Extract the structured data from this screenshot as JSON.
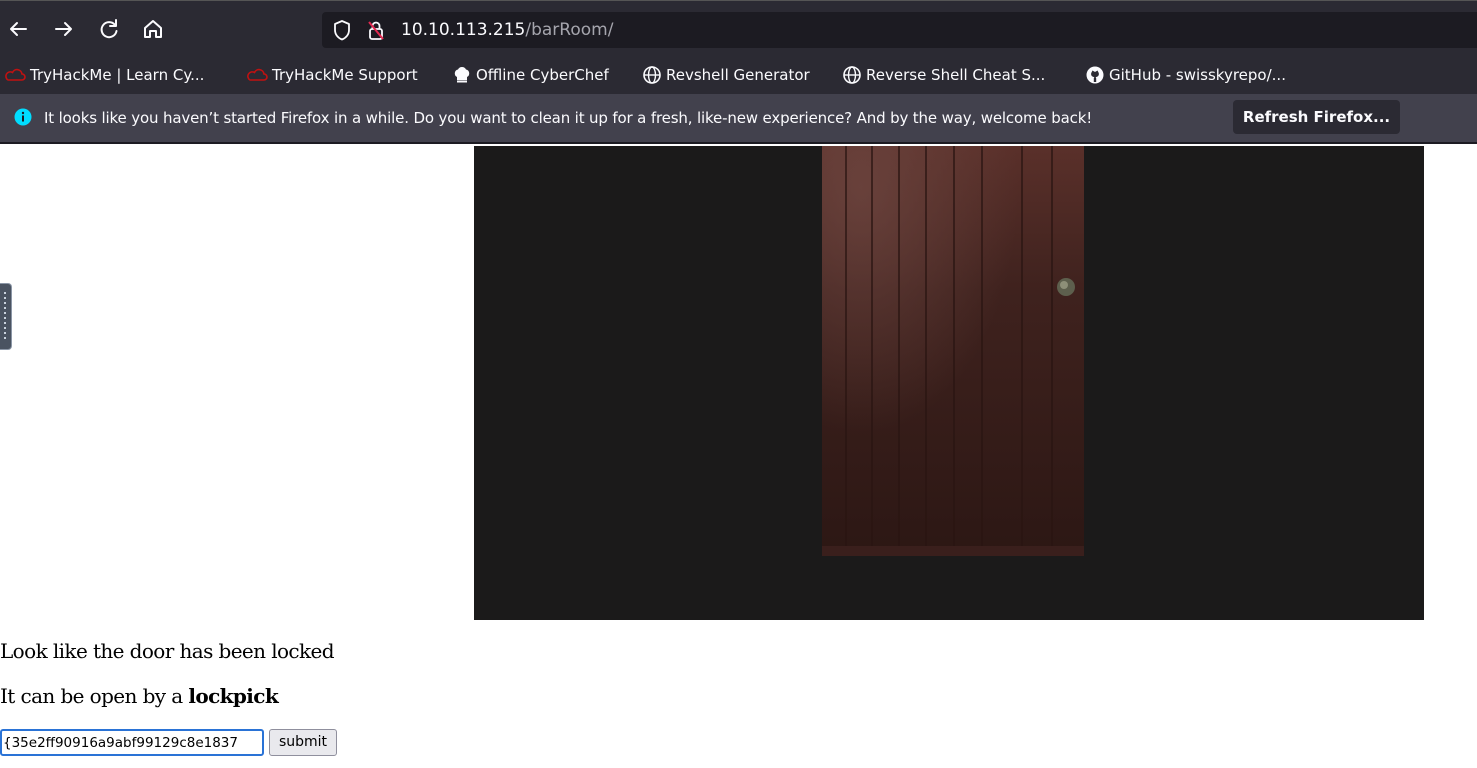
{
  "toolbar": {
    "back_icon": "back-arrow-icon",
    "forward_icon": "forward-arrow-icon",
    "reload_icon": "reload-icon",
    "home_icon": "home-icon",
    "url_host": "10.10.113.215",
    "url_path": "/barRoom/"
  },
  "bookmarks": [
    {
      "label": "TryHackMe | Learn Cy...",
      "icon": "tryhackme-icon"
    },
    {
      "label": "TryHackMe Support",
      "icon": "tryhackme-icon"
    },
    {
      "label": "Offline CyberChef",
      "icon": "chef-hat-icon"
    },
    {
      "label": "Revshell Generator",
      "icon": "globe-icon"
    },
    {
      "label": "Reverse Shell Cheat S...",
      "icon": "globe-icon"
    },
    {
      "label": "GitHub - swisskyrepo/...",
      "icon": "github-icon"
    }
  ],
  "notification": {
    "message": "It looks like you haven’t started Firefox in a while. Do you want to clean it up for a fresh, like-new experience? And by the way, welcome back!",
    "button_label": "Refresh Firefox..."
  },
  "page": {
    "line1": "Look like the door has been locked",
    "line2_prefix": "It can be open by a ",
    "line2_bold": "lockpick",
    "input_value": "35e2ff90916a9abf99129c8e1837}",
    "submit_label": "submit"
  },
  "colors": {
    "toolbar_bg": "#2b2a33",
    "urlbar_bg": "#1c1b22",
    "notification_bg": "#42414d",
    "tryhackme_red": "#c11111",
    "info_blue": "#0060df",
    "focus_blue": "#2a73d6"
  }
}
